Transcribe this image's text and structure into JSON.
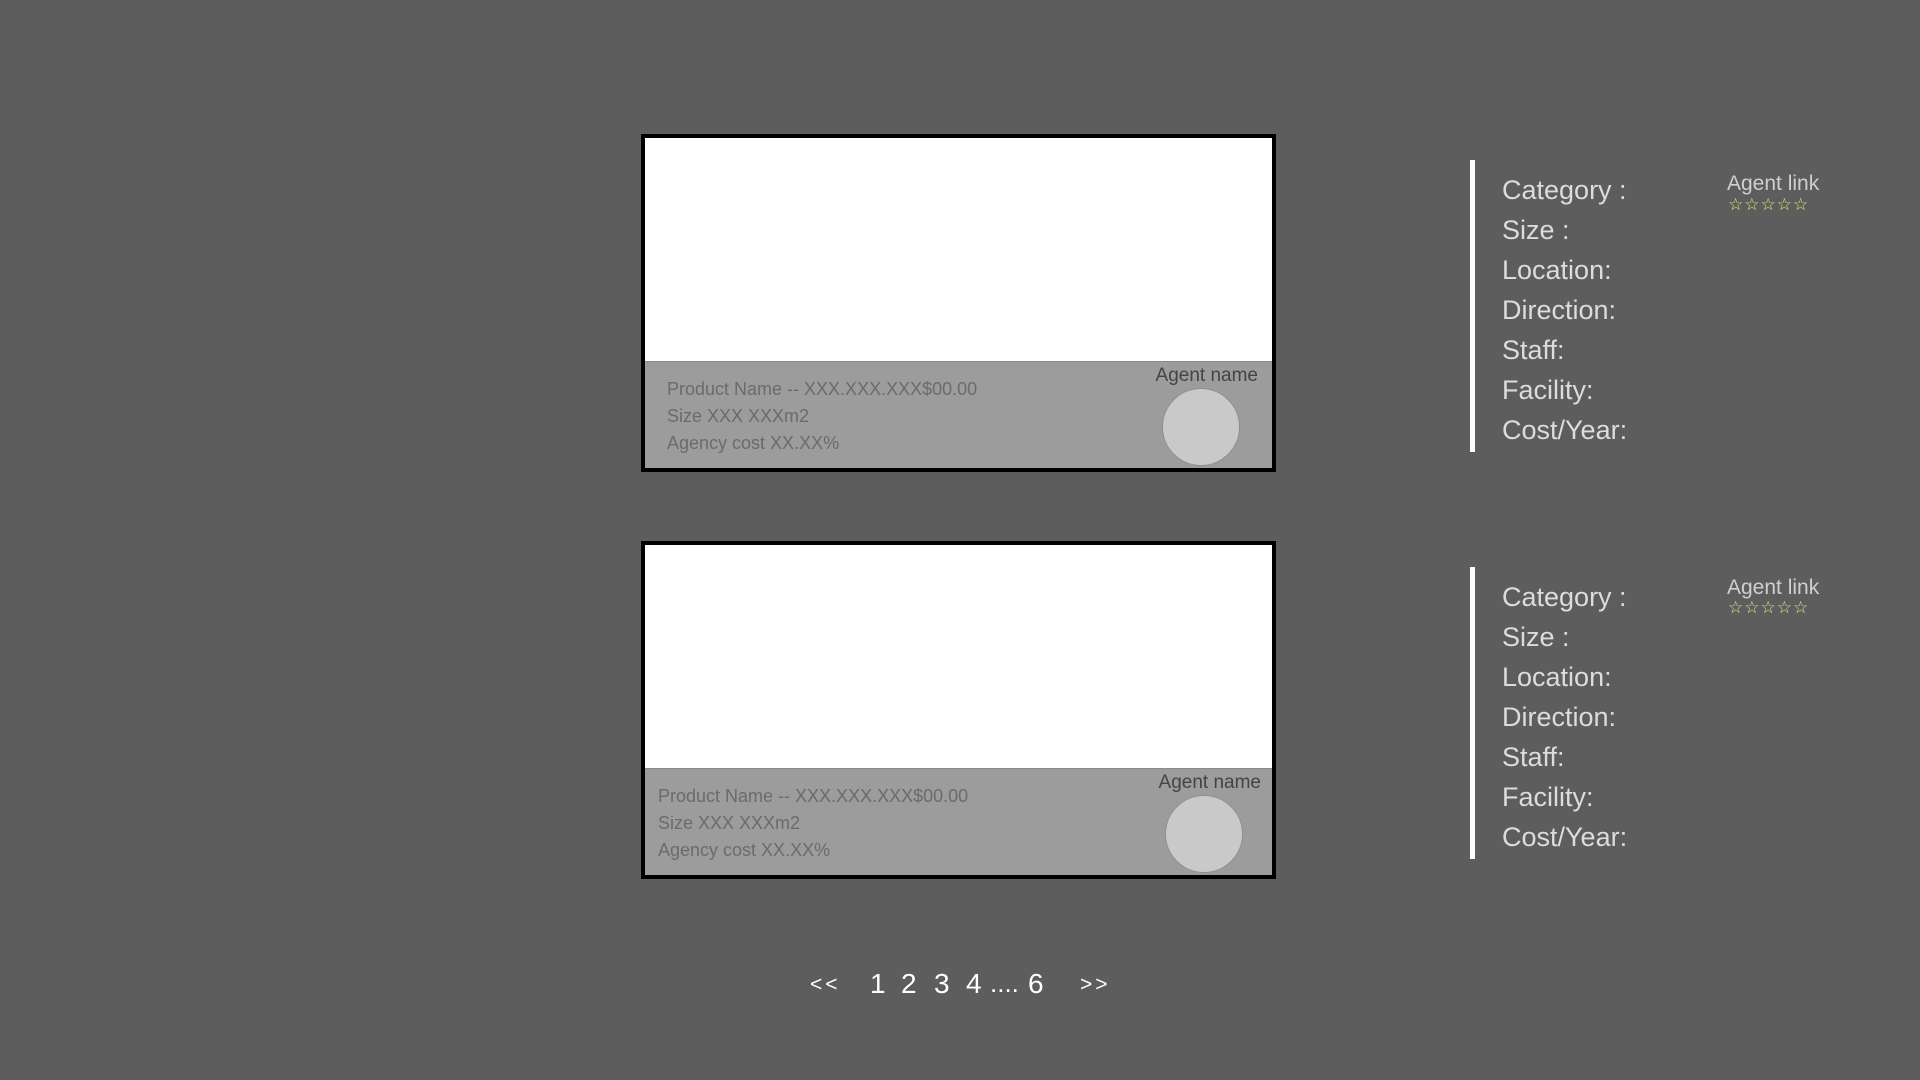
{
  "listings": [
    {
      "product_line": "Product Name -- XXX.XXX.XXX$00.00",
      "size_line": "Size XXX XXXm2",
      "agency_line": "Agency cost XX.XX%",
      "agent_name": "Agent name"
    },
    {
      "product_line": "Product Name -- XXX.XXX.XXX$00.00",
      "size_line": "Size XXX XXXm2",
      "agency_line": "Agency cost XX.XX%",
      "agent_name": "Agent name"
    }
  ],
  "details": [
    {
      "fields": [
        "Category :",
        "Size :",
        "Location:",
        "Direction:",
        "Staff:",
        "Facility:",
        "Cost/Year:"
      ],
      "agent_link": "Agent link",
      "rating": {
        "stars": [
          "☆",
          "☆",
          "☆",
          "☆",
          "☆"
        ],
        "filled": 0,
        "max": 5
      }
    },
    {
      "fields": [
        "Category :",
        "Size :",
        "Location:",
        "Direction:",
        "Staff:",
        "Facility:",
        "Cost/Year:"
      ],
      "agent_link": "Agent link",
      "rating": {
        "stars": [
          "☆",
          "☆",
          "☆",
          "☆",
          "☆"
        ],
        "filled": 0,
        "max": 5
      }
    }
  ],
  "pagination": {
    "prev": "<<",
    "pages": [
      "1",
      "2",
      "3",
      "4"
    ],
    "ellipsis": "....",
    "last": "6",
    "next": ">>"
  },
  "colors": {
    "background": "#5d5d5d",
    "card_border": "#000000",
    "card_footer": "#9c9c9c",
    "avatar": "#c9c9c9",
    "star": "#e8e07a",
    "panel_rule": "#ffffff"
  }
}
